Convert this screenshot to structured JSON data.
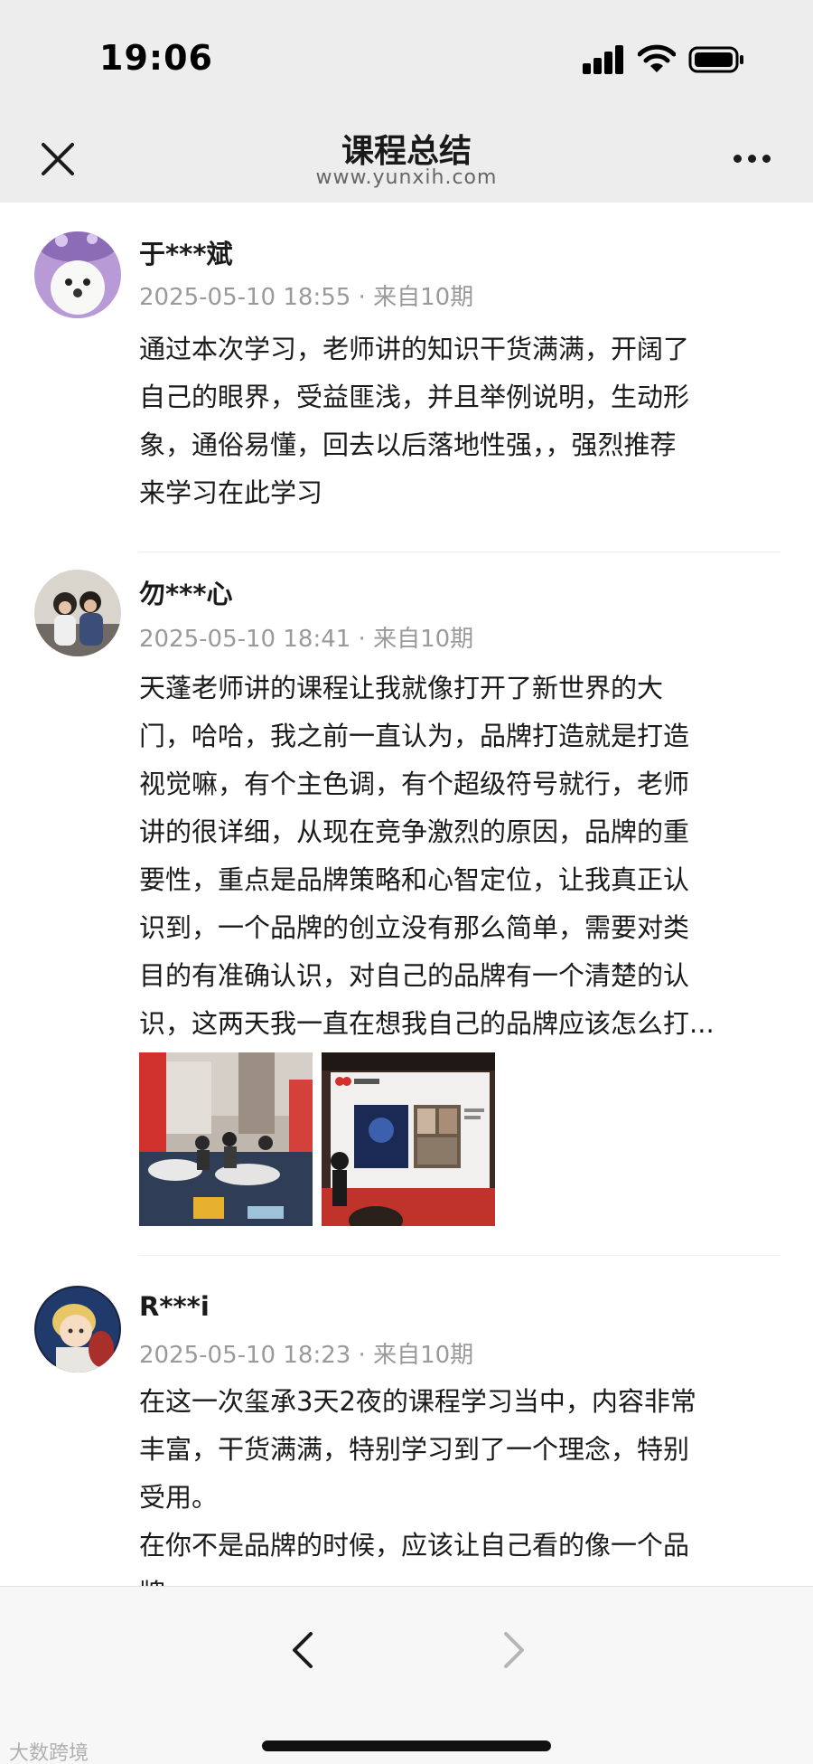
{
  "status_bar": {
    "time": "19:06"
  },
  "header": {
    "title": "课程总结",
    "subtitle": "www.yunxih.com"
  },
  "posts": [
    {
      "username": "于***斌",
      "meta": "2025-05-10 18:55 · 来自10期",
      "lines": [
        "通过本次学习，老师讲的知识干货满满，开阔了",
        "自己的眼界，受益匪浅，并且举例说明，生动形",
        "象，通俗易懂，回去以后落地性强，，强烈推荐",
        "来学习在此学习"
      ]
    },
    {
      "username": "勿***心",
      "meta": "2025-05-10 18:41 · 来自10期",
      "lines": [
        "天蓬老师讲的课程让我就像打开了新世界的大",
        "门，哈哈，我之前一直认为，品牌打造就是打造",
        "视觉嘛，有个主色调，有个超级符号就行，老师",
        "讲的很详细，从现在竞争激烈的原因，品牌的重",
        "要性，重点是品牌策略和心智定位，让我真正认",
        "识到，一个品牌的创立没有那么简单，需要对类",
        "目的有准确认识，对自己的品牌有一个清楚的认",
        "识，这两天我一直在想我自己的品牌应该怎么打..."
      ]
    },
    {
      "username": "R***i",
      "meta": "2025-05-10 18:23 · 来自10期",
      "lines": [
        "在这一次玺承3天2夜的课程学习当中，内容非常",
        "丰富，干货满满，特别学习到了一个理念，特别",
        "受用。",
        "在你不是品牌的时候，应该让自己看的像一个品",
        "牌。"
      ]
    }
  ],
  "watermark": "大数跨境",
  "icons": {
    "close": "close-icon",
    "more": "more-icon",
    "back": "chevron-left-icon",
    "forward": "chevron-right-icon"
  }
}
